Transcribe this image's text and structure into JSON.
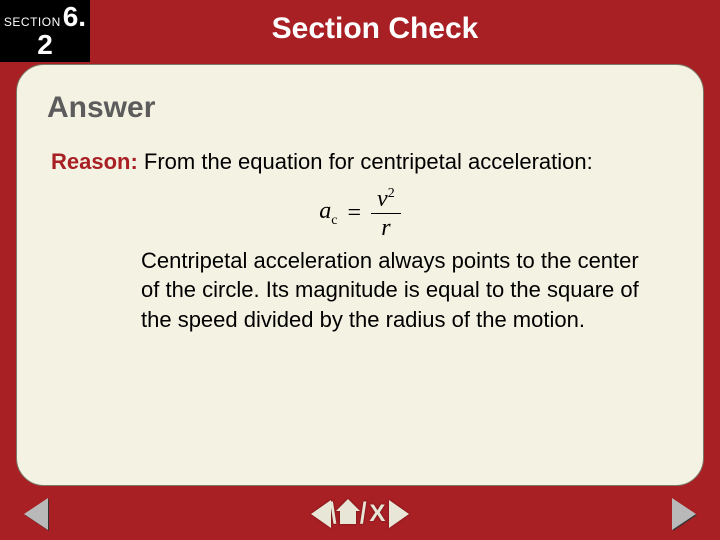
{
  "header": {
    "section_label": "SECTION",
    "section_top": "6.",
    "section_bottom": "2",
    "title": "Section Check"
  },
  "panel": {
    "answer_heading": "Answer",
    "reason_label": "Reason:",
    "reason_text": " From the equation for centripetal acceleration:",
    "equation": {
      "a": "a",
      "csub": "c",
      "equals": "=",
      "v": "v",
      "sq": "2",
      "r": "r"
    },
    "explanation": "Centripetal acceleration always points to the center of the circle. Its magnitude is equal to the square of the speed divided by the radius of the motion."
  },
  "footer": {
    "slash1": "\\",
    "slash2": "/",
    "close": "X"
  }
}
